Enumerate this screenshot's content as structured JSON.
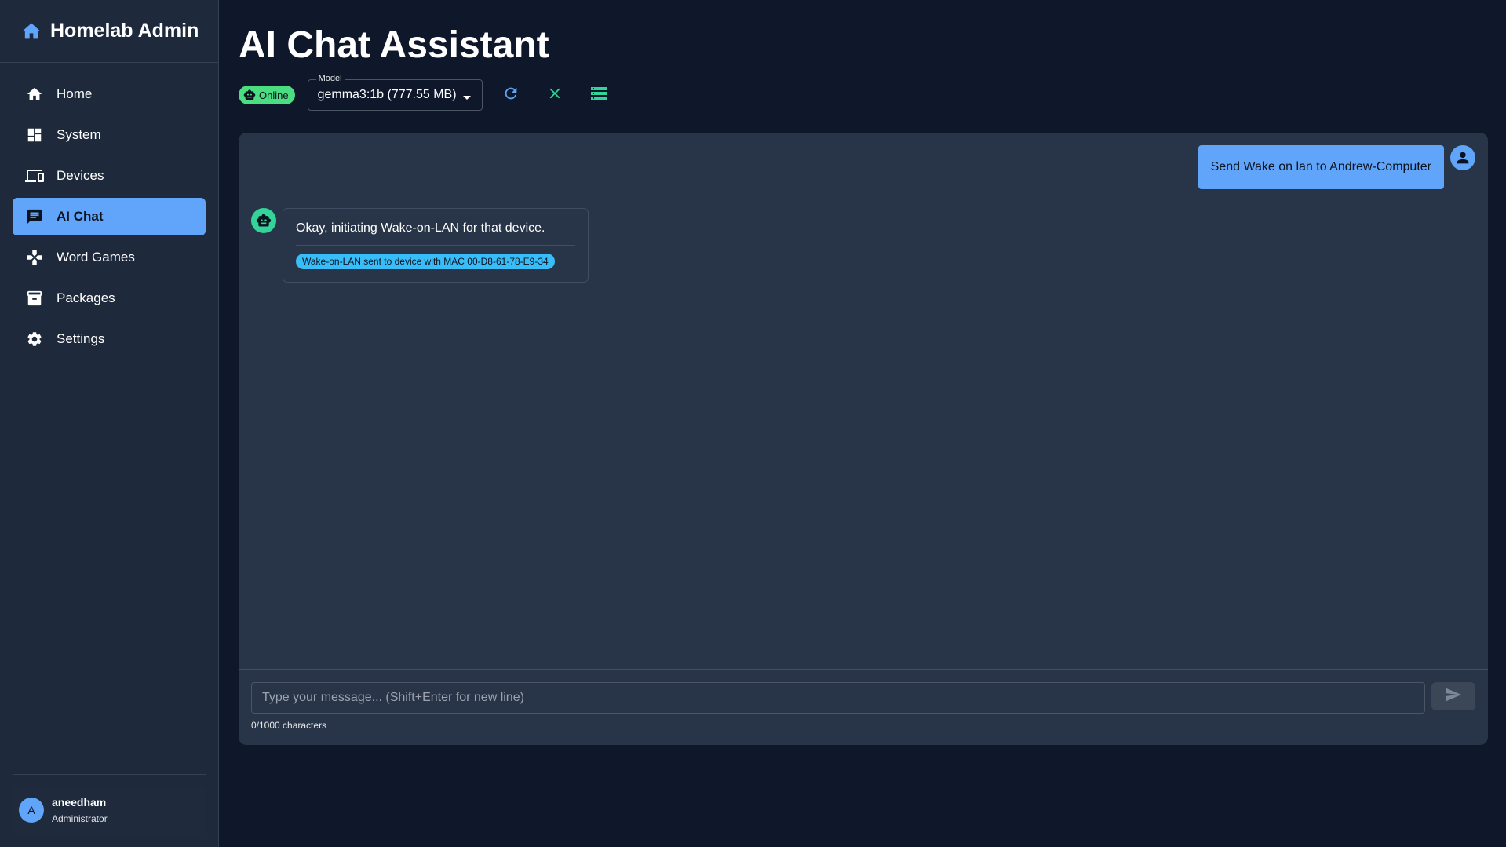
{
  "app": {
    "title": "Homelab Admin"
  },
  "sidebar": {
    "items": [
      {
        "label": "Home",
        "icon": "home-icon"
      },
      {
        "label": "System",
        "icon": "dashboard-icon"
      },
      {
        "label": "Devices",
        "icon": "devices-icon"
      },
      {
        "label": "AI Chat",
        "icon": "chat-icon",
        "active": true
      },
      {
        "label": "Word Games",
        "icon": "gamepad-icon"
      },
      {
        "label": "Packages",
        "icon": "archive-icon"
      },
      {
        "label": "Settings",
        "icon": "gear-icon"
      }
    ],
    "user": {
      "initial": "A",
      "name": "aneedham",
      "role": "Administrator"
    }
  },
  "page": {
    "title": "AI Chat Assistant"
  },
  "toolbar": {
    "status": "Online",
    "model_label": "Model",
    "model_value": "gemma3:1b (777.55 MB)",
    "actions": [
      "refresh-icon",
      "close-icon",
      "list-icon"
    ]
  },
  "chat": {
    "messages": [
      {
        "role": "user",
        "text": "Send Wake on lan to Andrew-Computer"
      },
      {
        "role": "assistant",
        "text": "Okay, initiating Wake-on-LAN for that device.",
        "result": "Wake-on-LAN sent to device with MAC 00-D8-61-78-E9-34"
      }
    ],
    "input_placeholder": "Type your message... (Shift+Enter for new line)",
    "char_count": "0/1000 characters"
  },
  "colors": {
    "background": "#0f172a",
    "sidebar": "#1e293b",
    "accent": "#60a5fa",
    "online": "#4ade80",
    "bot": "#34d399",
    "result_chip": "#38bdf8"
  }
}
